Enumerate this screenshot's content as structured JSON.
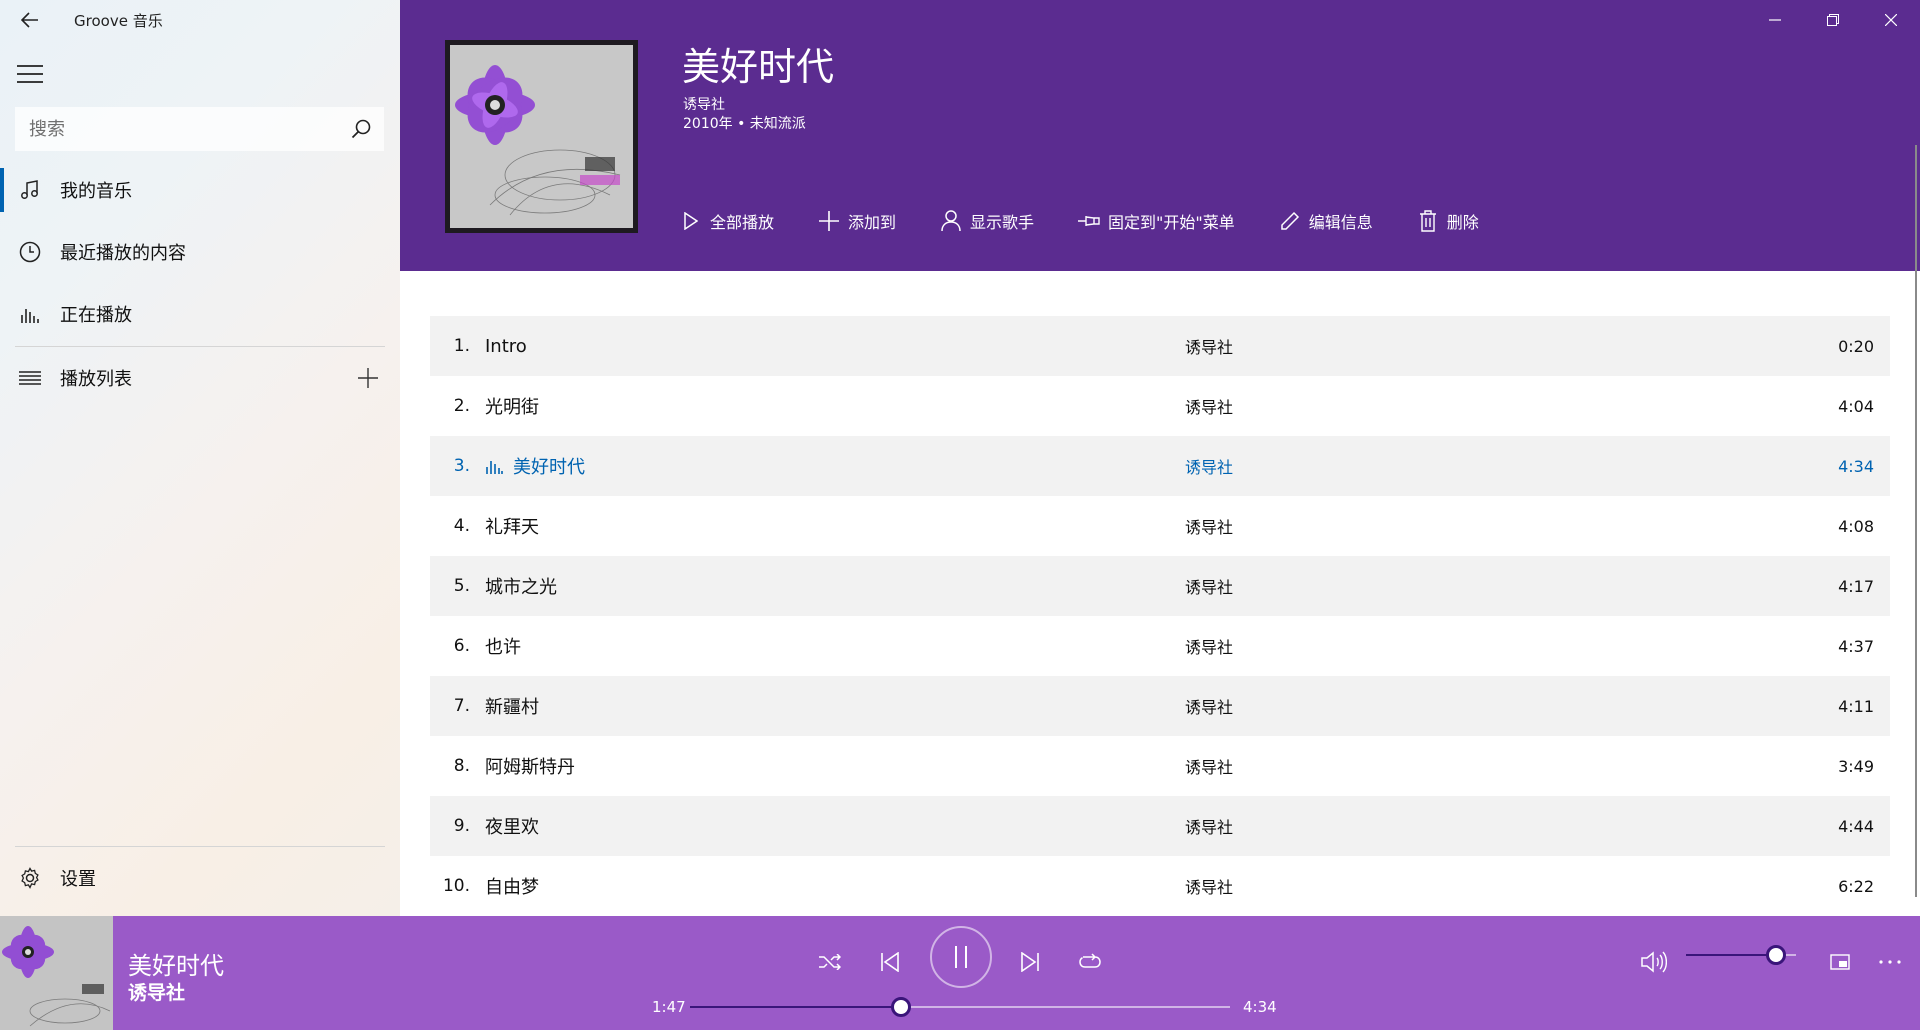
{
  "app": {
    "title": "Groove 音乐"
  },
  "colors": {
    "header_bg": "#5b2c90",
    "player_bg": "#9a5ac8",
    "accent": "#0063b1"
  },
  "search": {
    "placeholder": "搜索"
  },
  "sidebar": {
    "items": [
      {
        "label": "我的音乐",
        "icon": "music-note-icon",
        "active": true
      },
      {
        "label": "最近播放的内容",
        "icon": "clock-icon"
      },
      {
        "label": "正在播放",
        "icon": "equalizer-icon"
      },
      {
        "label": "播放列表",
        "icon": "list-icon"
      }
    ],
    "settings_label": "设置"
  },
  "album": {
    "title": "美好时代",
    "artist": "诱导社",
    "meta": "2010年 • 未知流派"
  },
  "actions": [
    {
      "label": "全部播放",
      "icon": "play-icon"
    },
    {
      "label": "添加到",
      "icon": "plus-icon"
    },
    {
      "label": "显示歌手",
      "icon": "person-icon"
    },
    {
      "label": "固定到\"开始\"菜单",
      "icon": "pin-icon"
    },
    {
      "label": "编辑信息",
      "icon": "pencil-icon"
    },
    {
      "label": "删除",
      "icon": "trash-icon"
    }
  ],
  "tracks": [
    {
      "num": "1.",
      "title": "Intro",
      "artist": "诱导社",
      "duration": "0:20"
    },
    {
      "num": "2.",
      "title": "光明街",
      "artist": "诱导社",
      "duration": "4:04"
    },
    {
      "num": "3.",
      "title": "美好时代",
      "artist": "诱导社",
      "duration": "4:34",
      "playing": true
    },
    {
      "num": "4.",
      "title": "礼拜天",
      "artist": "诱导社",
      "duration": "4:08"
    },
    {
      "num": "5.",
      "title": "城市之光",
      "artist": "诱导社",
      "duration": "4:17"
    },
    {
      "num": "6.",
      "title": "也许",
      "artist": "诱导社",
      "duration": "4:37"
    },
    {
      "num": "7.",
      "title": "新疆村",
      "artist": "诱导社",
      "duration": "4:11"
    },
    {
      "num": "8.",
      "title": "阿姆斯特丹",
      "artist": "诱导社",
      "duration": "3:49"
    },
    {
      "num": "9.",
      "title": "夜里欢",
      "artist": "诱导社",
      "duration": "4:44"
    },
    {
      "num": "10.",
      "title": "自由梦",
      "artist": "诱导社",
      "duration": "6:22"
    }
  ],
  "now_playing": {
    "title": "美好时代",
    "artist": "诱导社",
    "elapsed": "1:47",
    "total": "4:34",
    "progress_fraction": 0.39,
    "volume_fraction": 0.82
  }
}
